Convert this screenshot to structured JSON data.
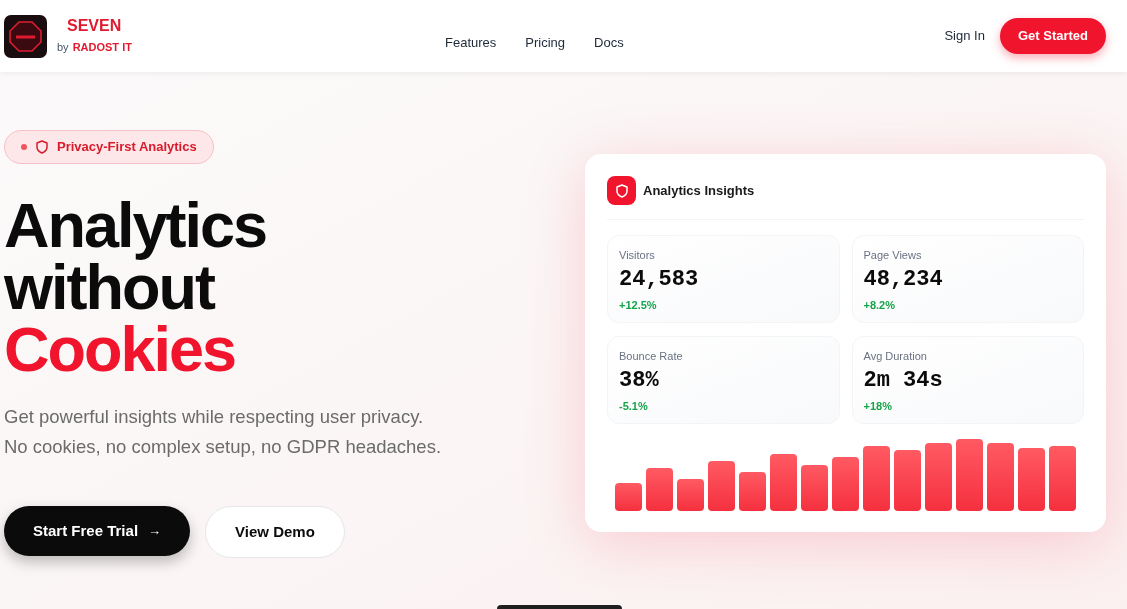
{
  "brand": {
    "name": "SEVEN",
    "by": "by",
    "company": "RADOST IT"
  },
  "nav": {
    "links": [
      "Features",
      "Pricing",
      "Docs"
    ],
    "sign_in": "Sign In",
    "cta": "Get Started"
  },
  "hero": {
    "badge": "Privacy-First Analytics",
    "headline": [
      "Analytics",
      "without"
    ],
    "headline_accent": "Cookies",
    "subtitle": [
      "Get powerful insights while respecting user privacy.",
      "No cookies, no complex setup, no GDPR headaches."
    ],
    "primary_button": "Start Free Trial",
    "arrow": "→",
    "secondary_button": "View Demo"
  },
  "card": {
    "title": "Analytics Insights",
    "stats": [
      {
        "label": "Visitors",
        "value": "24,583",
        "change": "+12.5%"
      },
      {
        "label": "Page Views",
        "value": "48,234",
        "change": "+8.2%"
      },
      {
        "label": "Bounce Rate",
        "value": "38%",
        "change": "-5.1%"
      },
      {
        "label": "Avg Duration",
        "value": "2m 34s",
        "change": "+18%"
      }
    ]
  }
}
